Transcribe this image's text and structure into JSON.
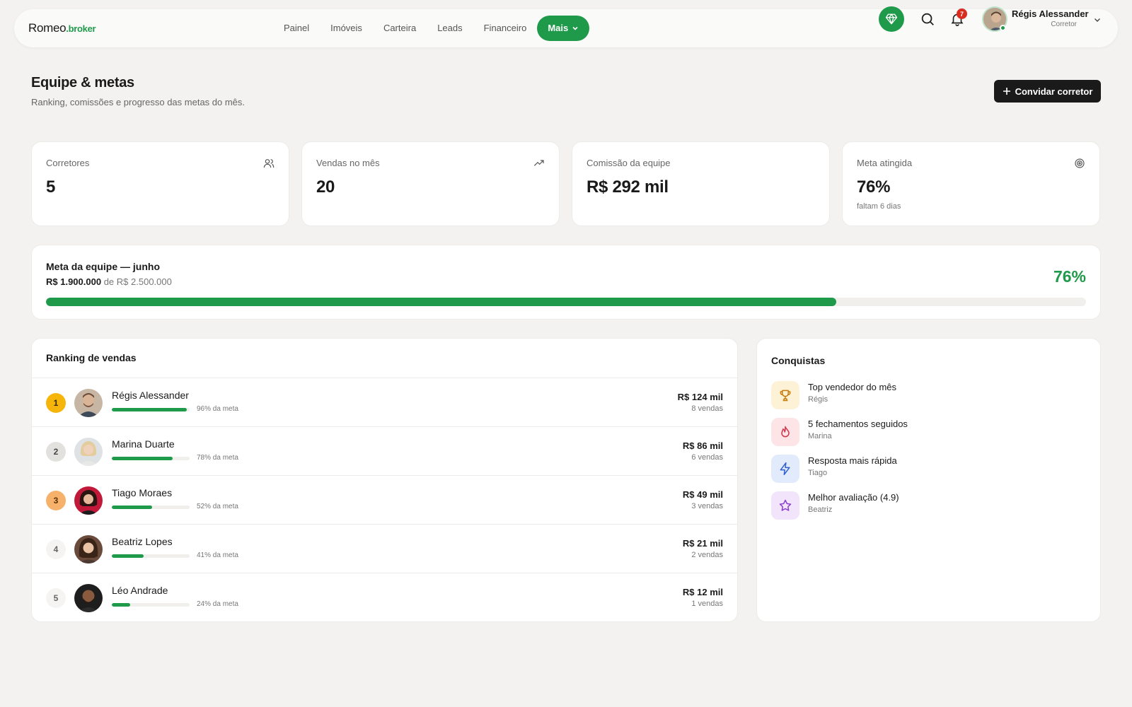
{
  "brand": {
    "name": "Romeo",
    "suffix": ".broker"
  },
  "nav": {
    "items": [
      "Painel",
      "Imóveis",
      "Carteira",
      "Leads",
      "Financeiro"
    ],
    "more_label": "Mais"
  },
  "notifications": {
    "count": "7"
  },
  "user": {
    "name": "Régis Alessander",
    "role": "Corretor"
  },
  "header": {
    "title": "Equipe & metas",
    "subtitle": "Ranking, comissões e progresso das metas do mês.",
    "invite_label": "Convidar corretor"
  },
  "stats": [
    {
      "label": "Corretores",
      "value": "5",
      "note": "",
      "icon": "users-icon"
    },
    {
      "label": "Vendas no mês",
      "value": "20",
      "note": "",
      "icon": "trending-up-icon"
    },
    {
      "label": "Comissão da equipe",
      "value": "R$ 292 mil",
      "note": "",
      "icon": ""
    },
    {
      "label": "Meta atingida",
      "value": "76%",
      "note": "faltam 6 dias",
      "icon": "target-icon"
    }
  ],
  "team_goal": {
    "title": "Meta da equipe — junho",
    "achieved": "R$ 1.900.000",
    "of_label": "de",
    "target": "R$ 2.500.000",
    "percent_label": "76%",
    "progress": 0.76
  },
  "ranking": {
    "title": "Ranking de vendas",
    "rows": [
      {
        "rank": "1",
        "name": "Régis Alessander",
        "progress": 0.96,
        "meta": "96% da meta",
        "amount": "R$ 124 mil",
        "sales": "8 vendas",
        "badge_bg": "#f5b50a",
        "badge_fg": "#3a2a00"
      },
      {
        "rank": "2",
        "name": "Marina Duarte",
        "progress": 0.78,
        "meta": "78% da meta",
        "amount": "R$ 86 mil",
        "sales": "6 vendas",
        "badge_bg": "#e3e1dd",
        "badge_fg": "#444444"
      },
      {
        "rank": "3",
        "name": "Tiago Moraes",
        "progress": 0.52,
        "meta": "52% da meta",
        "amount": "R$ 49 mil",
        "sales": "3 vendas",
        "badge_bg": "#f6b26b",
        "badge_fg": "#5a2e00"
      },
      {
        "rank": "4",
        "name": "Beatriz Lopes",
        "progress": 0.41,
        "meta": "41% da meta",
        "amount": "R$ 21 mil",
        "sales": "2 vendas",
        "badge_bg": "#f5f4f2",
        "badge_fg": "#666666"
      },
      {
        "rank": "5",
        "name": "Léo Andrade",
        "progress": 0.24,
        "meta": "24% da meta",
        "amount": "R$ 12 mil",
        "sales": "1 vendas",
        "badge_bg": "#f5f4f2",
        "badge_fg": "#666666"
      }
    ]
  },
  "achievements": {
    "title": "Conquistas",
    "items": [
      {
        "label": "Top vendedor do mês",
        "who": "Régis",
        "icon": "trophy-icon",
        "bg": "#fdf1d6",
        "fg": "#c77a06"
      },
      {
        "label": "5 fechamentos seguidos",
        "who": "Marina",
        "icon": "flame-icon",
        "bg": "#fde4e6",
        "fg": "#d0324a"
      },
      {
        "label": "Resposta mais rápida",
        "who": "Tiago",
        "icon": "lightning-icon",
        "bg": "#e2ebfc",
        "fg": "#2f5fd0"
      },
      {
        "label": "Melhor avaliação (4.9)",
        "who": "Beatriz",
        "icon": "star-icon",
        "bg": "#f1e4fb",
        "fg": "#8a3fcf"
      }
    ]
  },
  "colors": {
    "accent": "#1f9a4a",
    "dark": "#1a1a1a",
    "background": "#f3f2f0"
  }
}
